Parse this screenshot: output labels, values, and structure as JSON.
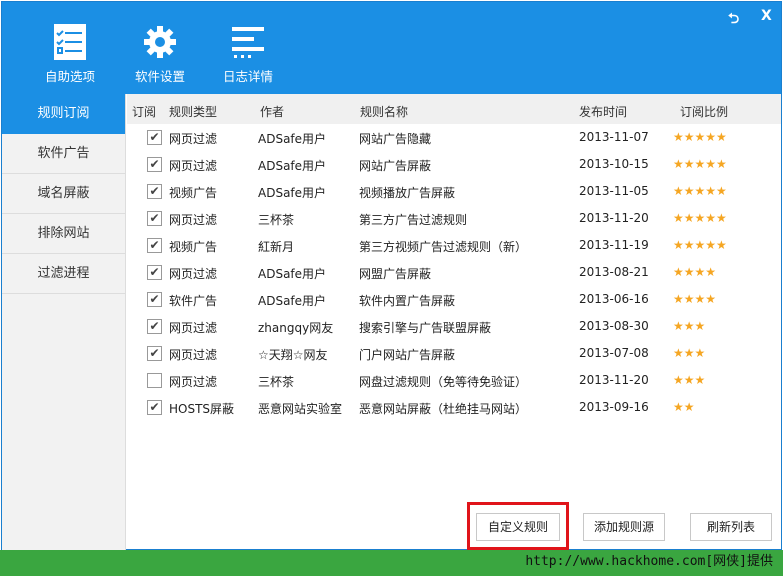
{
  "toolbar": {
    "items": [
      {
        "label": "自助选项",
        "icon": "checklist-icon"
      },
      {
        "label": "软件设置",
        "icon": "gear-icon"
      },
      {
        "label": "日志详情",
        "icon": "log-icon"
      }
    ],
    "restore": "⮌",
    "close": "X"
  },
  "sidebar": {
    "items": [
      {
        "label": "规则订阅",
        "active": true
      },
      {
        "label": "软件广告"
      },
      {
        "label": "域名屏蔽"
      },
      {
        "label": "排除网站"
      },
      {
        "label": "过滤进程"
      }
    ]
  },
  "table": {
    "headers": [
      "订阅",
      "规则类型",
      "作者",
      "规则名称",
      "发布时间",
      "订阅比例"
    ],
    "rows": [
      {
        "checked": true,
        "type": "网页过滤",
        "author": "ADSafe用户",
        "name": "网站广告隐藏",
        "date": "2013-11-07",
        "stars": "★★★★★"
      },
      {
        "checked": true,
        "type": "网页过滤",
        "author": "ADSafe用户",
        "name": "网站广告屏蔽",
        "date": "2013-10-15",
        "stars": "★★★★★"
      },
      {
        "checked": true,
        "type": "视频广告",
        "author": "ADSafe用户",
        "name": "视频播放广告屏蔽",
        "date": "2013-11-05",
        "stars": "★★★★★"
      },
      {
        "checked": true,
        "type": "网页过滤",
        "author": "三杯茶",
        "name": "第三方广告过滤规则",
        "date": "2013-11-20",
        "stars": "★★★★★"
      },
      {
        "checked": true,
        "type": "视频广告",
        "author": "紅新月",
        "name": "第三方视频广告过滤规则（新）",
        "date": "2013-11-19",
        "stars": "★★★★★"
      },
      {
        "checked": true,
        "type": "网页过滤",
        "author": "ADSafe用户",
        "name": "网盟广告屏蔽",
        "date": "2013-08-21",
        "stars": "★★★★"
      },
      {
        "checked": true,
        "type": "软件广告",
        "author": "ADSafe用户",
        "name": "软件内置广告屏蔽",
        "date": "2013-06-16",
        "stars": "★★★★"
      },
      {
        "checked": true,
        "type": "网页过滤",
        "author": "zhangqy网友",
        "name": "搜索引擎与广告联盟屏蔽",
        "date": "2013-08-30",
        "stars": "★★★"
      },
      {
        "checked": true,
        "type": "网页过滤",
        "author": "☆天翔☆网友",
        "name": "门户网站广告屏蔽",
        "date": "2013-07-08",
        "stars": "★★★"
      },
      {
        "checked": false,
        "type": "网页过滤",
        "author": "三杯茶",
        "name": "网盘过滤规则（免等待免验证）",
        "date": "2013-11-20",
        "stars": "★★★"
      },
      {
        "checked": true,
        "type": "HOSTS屏蔽",
        "author": "恶意网站实验室",
        "name": "恶意网站屏蔽（杜绝挂马网站）",
        "date": "2013-09-16",
        "stars": "★★"
      }
    ]
  },
  "buttons": {
    "custom": "自定义规则",
    "add_source": "添加规则源",
    "refresh": "刷新列表"
  },
  "footer": "http://www.hackhome.com[网侠]提供",
  "colors": {
    "header": "#1b8fe4",
    "footer": "#3aa640",
    "highlight": "#e0141a",
    "star": "#f5a623"
  }
}
